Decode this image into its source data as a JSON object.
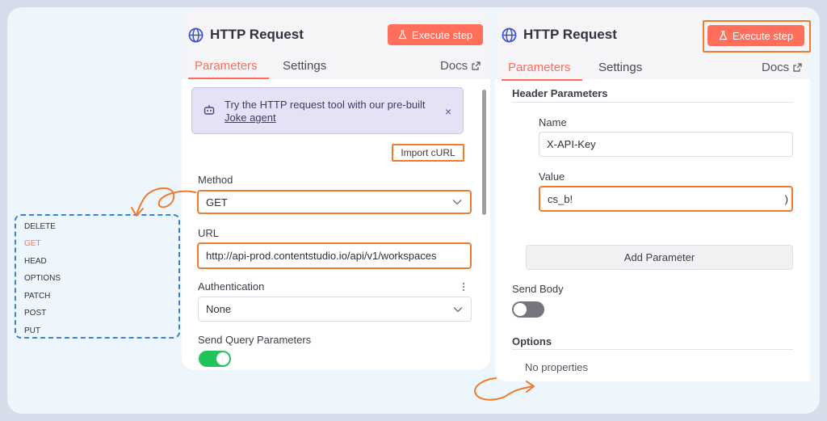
{
  "left_panel": {
    "title": "HTTP Request",
    "execute_label": "Execute step",
    "tabs": {
      "parameters": "Parameters",
      "settings": "Settings",
      "docs": "Docs"
    },
    "banner": {
      "text": "Try the HTTP request tool with our pre-built",
      "link": "Joke agent",
      "close": "×"
    },
    "import_curl": "Import cURL",
    "method": {
      "label": "Method",
      "value": "GET"
    },
    "url": {
      "label": "URL",
      "value": "http://api-prod.contentstudio.io/api/v1/workspaces"
    },
    "authentication": {
      "label": "Authentication",
      "value": "None"
    },
    "send_query": {
      "label": "Send Query Parameters",
      "enabled": true
    }
  },
  "right_panel": {
    "title": "HTTP Request",
    "execute_label": "Execute step",
    "tabs": {
      "parameters": "Parameters",
      "settings": "Settings",
      "docs": "Docs"
    },
    "header_parameters": {
      "title": "Header Parameters",
      "name_label": "Name",
      "name_value": "X-API-Key",
      "value_label": "Value",
      "value_value": "cs_b!",
      "value_tail": ")"
    },
    "add_parameter": "Add Parameter",
    "send_body": {
      "label": "Send Body",
      "enabled": false
    },
    "options": {
      "title": "Options",
      "empty": "No properties"
    }
  },
  "method_dropdown": {
    "items": [
      "DELETE",
      "GET",
      "HEAD",
      "OPTIONS",
      "PATCH",
      "POST",
      "PUT"
    ],
    "selected": "GET"
  },
  "colors": {
    "accent": "#ff6d5a",
    "highlight": "#f07b2f",
    "toggle_on": "#20c35a",
    "dashed_border": "#3a82d4"
  }
}
